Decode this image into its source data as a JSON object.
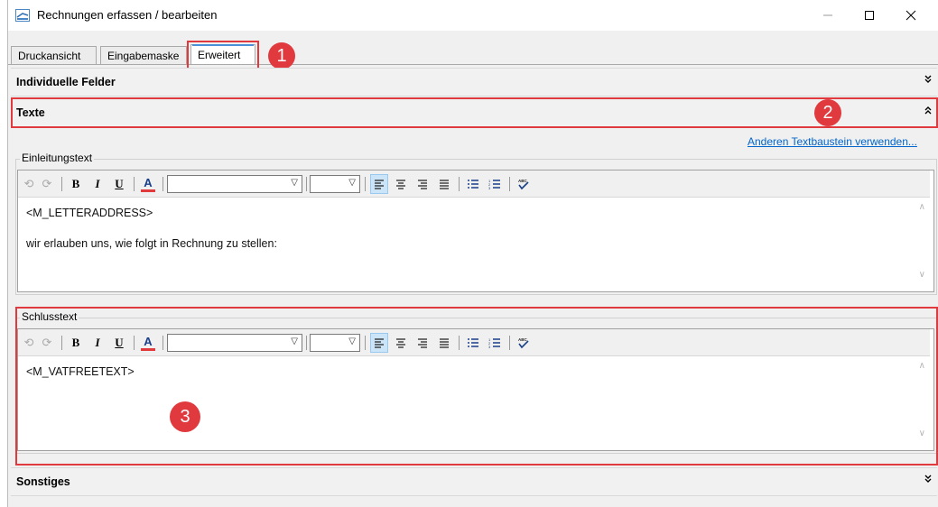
{
  "window": {
    "title": "Rechnungen erfassen / bearbeiten"
  },
  "tabs": [
    {
      "label": "Druckansicht"
    },
    {
      "label": "Eingabemaske"
    },
    {
      "label": "Erweitert"
    }
  ],
  "badges": [
    "1",
    "2",
    "3"
  ],
  "sections": {
    "individuelle": {
      "title": "Individuelle Felder",
      "chevron": "expand"
    },
    "texte": {
      "title": "Texte",
      "chevron": "collapse"
    },
    "sonstiges": {
      "title": "Sonstiges",
      "chevron": "expand"
    }
  },
  "link_text": "Anderen Textbaustein verwenden...",
  "einleitung": {
    "label": "Einleitungstext",
    "lines": [
      "<M_LETTERADDRESS>",
      "wir erlauben uns, wie folgt in Rechnung zu stellen:"
    ],
    "font_value": "",
    "size_value": ""
  },
  "schluss": {
    "label": "Schlusstext",
    "lines": [
      "<M_VATFREETEXT>"
    ],
    "font_value": "",
    "size_value": ""
  },
  "toolbar": {
    "bold": "B",
    "italic": "I",
    "underline": "U",
    "fontcolor": "A"
  },
  "colors": {
    "accent_red": "#e0393e",
    "link_blue": "#0066cc",
    "active_tab_line": "#4a90d9"
  }
}
